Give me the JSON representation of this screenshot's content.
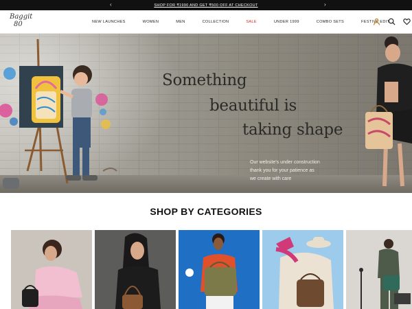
{
  "announcement": {
    "message": "SHOP FOR ₹1990 AND GET ₹500 OFF AT CHECKOUT",
    "prev_icon": "chevron-left-icon",
    "next_icon": "chevron-right-icon"
  },
  "brand": {
    "logo_line1": "Baggit",
    "logo_line2": "80"
  },
  "nav": {
    "items": [
      "NEW LAUNCHES",
      "WOMEN",
      "MEN",
      "COLLECTION",
      "SALE",
      "UNDER 1999",
      "COMBO SETS",
      "FESTIVE EDIT"
    ],
    "sale_color": "#d0281f"
  },
  "header_icons": [
    "account-icon",
    "search-icon",
    "wishlist-icon"
  ],
  "hero": {
    "headline_line1": "Something",
    "headline_line2": "beautiful is",
    "headline_line3": "taking shape",
    "subtext_line1": "Our website's under construction",
    "subtext_line2": "thank you for your patience as",
    "subtext_line3": "we create with care"
  },
  "categories": {
    "title": "SHOP BY CATEGORIES",
    "tiles": [
      {
        "bg": "#c9c2ba"
      },
      {
        "bg": "#5a5a58"
      },
      {
        "bg": "#1f73c9"
      },
      {
        "bg": "#8fc2e6"
      },
      {
        "bg": "#d9d6d1"
      }
    ]
  },
  "colors": {
    "topbar_bg": "#111111",
    "accent_sale": "#d0281f"
  }
}
